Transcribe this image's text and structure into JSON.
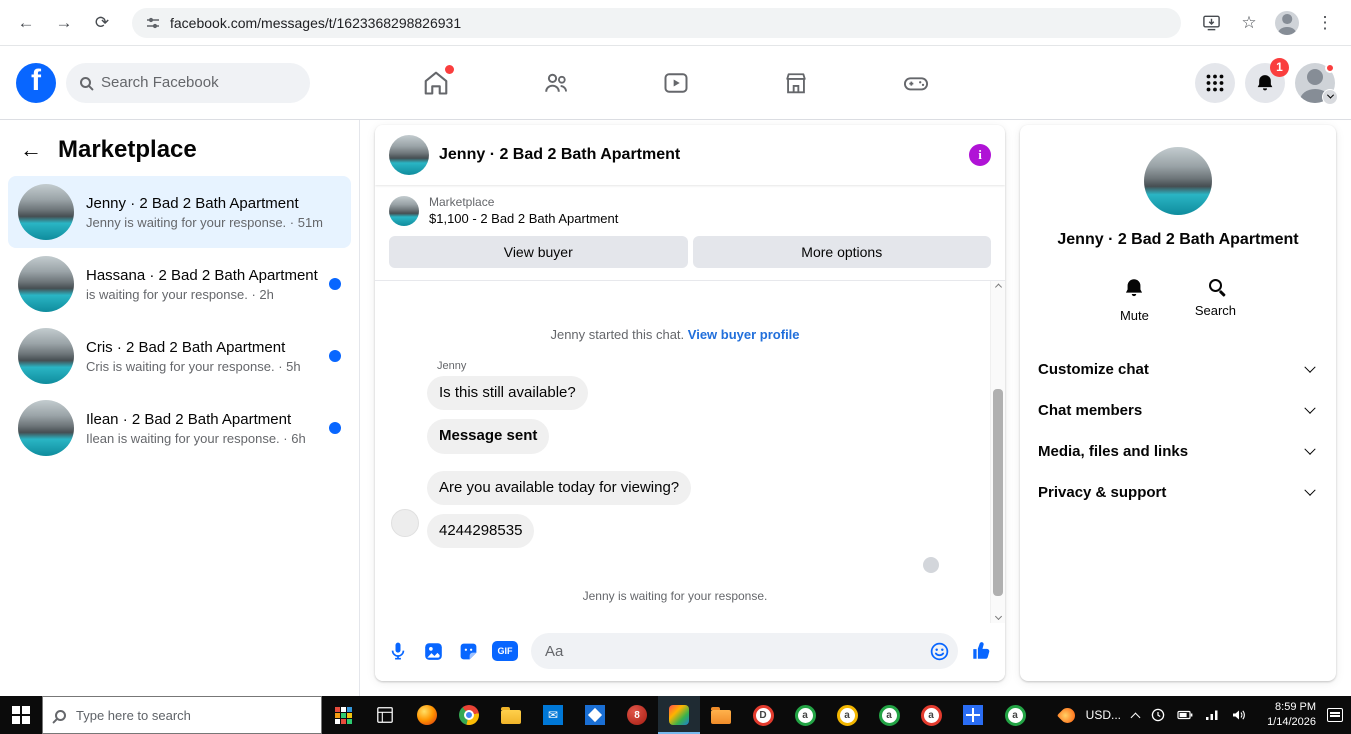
{
  "colors": {
    "accent_blue": "#0866ff",
    "link_blue": "#216fdb",
    "selected_chat_bg": "#e7f3ff",
    "unread_dot_blue": "#0866ff",
    "info_icon_purple": "#b013d6",
    "notification_red": "#fa3e3e"
  },
  "browser": {
    "url": "facebook.com/messages/t/1623368298826931"
  },
  "fb_header": {
    "logo": "f",
    "search_placeholder": "Search Facebook",
    "notification_badge": "1"
  },
  "sidebar": {
    "title": "Marketplace",
    "chats": [
      {
        "name": "Jenny · 2 Bad 2 Bath Apartment",
        "preview": "Jenny is waiting for your response.",
        "time": "· 51m"
      },
      {
        "name": "Hassana · 2 Bad 2 Bath Apartment",
        "preview": "is waiting for your response.",
        "time": "· 2h"
      },
      {
        "name": "Cris · 2 Bad 2 Bath Apartment",
        "preview": "Cris is waiting for your response.",
        "time": "· 5h"
      },
      {
        "name": "Ilean · 2 Bad 2 Bath Apartment",
        "preview": "Ilean is waiting for your response.",
        "time": "· 6h"
      }
    ]
  },
  "chat": {
    "title": "Jenny · 2 Bad 2 Bath Apartment",
    "product": {
      "source": "Marketplace",
      "title": "$1,100 - 2 Bad 2 Bath Apartment",
      "view_buyer_label": "View buyer",
      "more_options_label": "More options"
    },
    "system_note": "Jenny started this chat.",
    "system_link": "View buyer profile",
    "sender": "Jenny",
    "messages": [
      "Is this still available?",
      "Message sent",
      "Are you available today for viewing?",
      "4244298535"
    ],
    "status": "Jenny is waiting for your response.",
    "composer": {
      "placeholder": "Aa",
      "gif_label": "GIF"
    }
  },
  "right_panel": {
    "title": "Jenny · 2 Bad 2 Bath Apartment",
    "actions": [
      {
        "label": "Mute"
      },
      {
        "label": "Search"
      }
    ],
    "sections": [
      "Customize chat",
      "Chat members",
      "Media, files and links",
      "Privacy & support"
    ]
  },
  "taskbar": {
    "search_placeholder": "Type here to search",
    "red_app_label": "8",
    "profile_letters": [
      "D",
      "a",
      "a",
      "a",
      "a",
      "a"
    ],
    "tray": {
      "currency": "USD...",
      "time": "8:59 PM",
      "date": "1/14/2026"
    }
  }
}
